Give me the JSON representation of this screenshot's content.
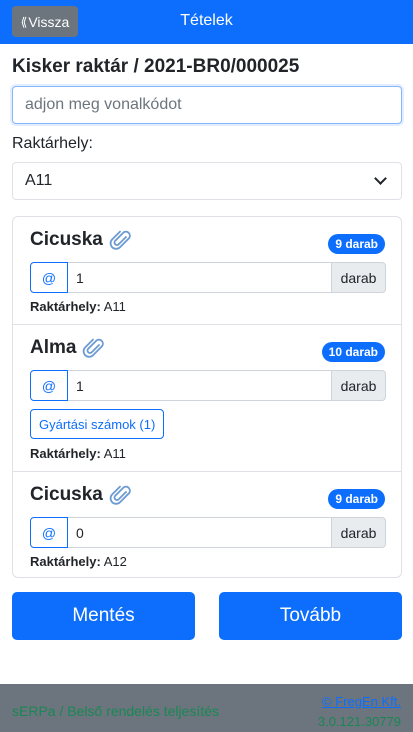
{
  "header": {
    "back_label": "Vissza",
    "back_glyph": "⟪",
    "title": "Tételek"
  },
  "document": {
    "title": "Kisker raktár / 2021-BR0/000025"
  },
  "barcode": {
    "value": "",
    "placeholder": "adjon meg vonalkódot"
  },
  "location_select": {
    "label": "Raktárhely:",
    "selected": "A11"
  },
  "items": [
    {
      "name": "Cicuska",
      "badge": "9 darab",
      "at": "@",
      "qty": "1",
      "unit": "darab",
      "loc_label": "Raktárhely:",
      "loc_value": "A11"
    },
    {
      "name": "Alma",
      "badge": "10 darab",
      "at": "@",
      "qty": "1",
      "unit": "darab",
      "serial_button": "Gyártási számok (1)",
      "loc_label": "Raktárhely:",
      "loc_value": "A11"
    },
    {
      "name": "Cicuska",
      "badge": "9 darab",
      "at": "@",
      "qty": "0",
      "unit": "darab",
      "loc_label": "Raktárhely:",
      "loc_value": "A12"
    }
  ],
  "actions": {
    "save_label": "Mentés",
    "next_label": "Tovább"
  },
  "footer": {
    "left_text": "sERPa / Belső rendelés teljesítés",
    "company_link": "© FregEn Kft.",
    "version": "3.0.121.30779"
  },
  "colors": {
    "primary": "#0d6efd",
    "secondary": "#6c757d",
    "success": "#198754"
  }
}
